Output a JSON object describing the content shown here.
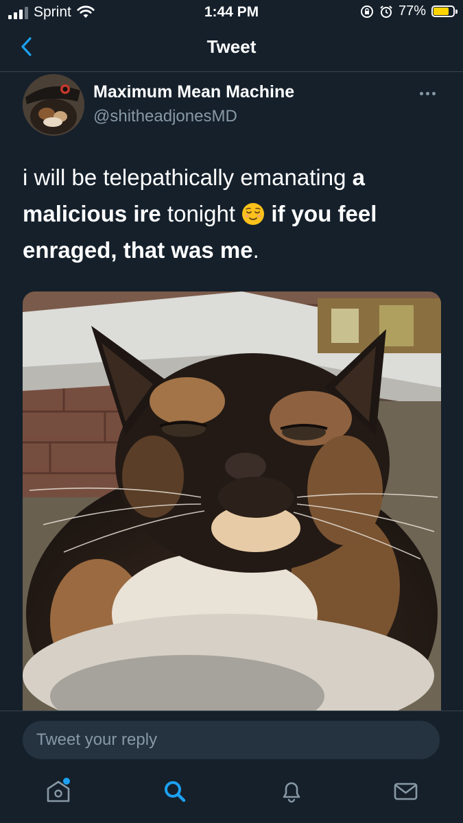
{
  "status_bar": {
    "carrier": "Sprint",
    "time": "1:44 PM",
    "battery": "77%",
    "battery_level": 0.77
  },
  "header": {
    "title": "Tweet"
  },
  "tweet": {
    "author_name": "Maximum Mean Machine",
    "author_handle": "@shitheadjonesMD",
    "text_parts": [
      {
        "text": "i will be telepathically emanating ",
        "bold": false
      },
      {
        "text": "a malicious ire",
        "bold": true
      },
      {
        "text": " tonight ",
        "bold": false
      },
      {
        "text": " if you feel enraged, that was me",
        "bold": true
      },
      {
        "text": ".",
        "bold": false
      }
    ],
    "emoji": "relieved-face-emoji"
  },
  "reply": {
    "placeholder": "Tweet your reply"
  },
  "tabs": [
    {
      "name": "tab-home",
      "icon": "home-icon"
    },
    {
      "name": "tab-search",
      "icon": "search-icon"
    },
    {
      "name": "tab-notifications",
      "icon": "bell-icon"
    },
    {
      "name": "tab-messages",
      "icon": "mail-icon"
    }
  ],
  "colors": {
    "background": "#15202b",
    "accent": "#1da1f2",
    "secondary_text": "#8899a6",
    "battery": "#ffd400"
  }
}
